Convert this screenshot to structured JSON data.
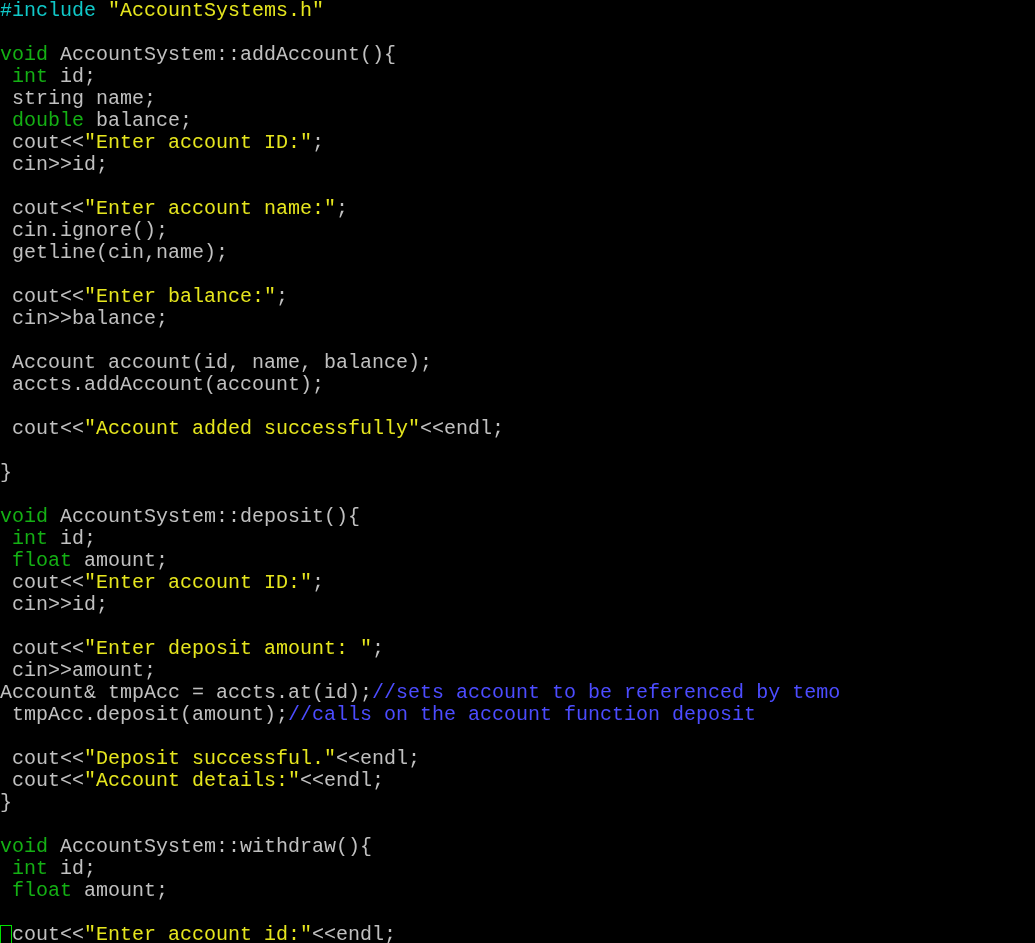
{
  "editor": {
    "lines": [
      {
        "kind": "code",
        "segments": [
          {
            "text": "#include ",
            "kind": "preproc"
          },
          {
            "text": "\"AccountSystems.h\"",
            "kind": "string"
          }
        ]
      },
      {
        "kind": "blank"
      },
      {
        "kind": "code",
        "segments": [
          {
            "text": "void",
            "kind": "keyword"
          },
          {
            "text": " AccountSystem::addAccount(){",
            "kind": "plain"
          }
        ]
      },
      {
        "kind": "code",
        "segments": [
          {
            "text": " int",
            "kind": "keyword"
          },
          {
            "text": " id;",
            "kind": "plain"
          }
        ]
      },
      {
        "kind": "code",
        "segments": [
          {
            "text": " string name;",
            "kind": "plain"
          }
        ]
      },
      {
        "kind": "code",
        "segments": [
          {
            "text": " double",
            "kind": "keyword"
          },
          {
            "text": " balance;",
            "kind": "plain"
          }
        ]
      },
      {
        "kind": "code",
        "segments": [
          {
            "text": " cout<<",
            "kind": "plain"
          },
          {
            "text": "\"Enter account ID:\"",
            "kind": "string"
          },
          {
            "text": ";",
            "kind": "plain"
          }
        ]
      },
      {
        "kind": "code",
        "segments": [
          {
            "text": " cin>>id;",
            "kind": "plain"
          }
        ]
      },
      {
        "kind": "blank"
      },
      {
        "kind": "code",
        "segments": [
          {
            "text": " cout<<",
            "kind": "plain"
          },
          {
            "text": "\"Enter account name:\"",
            "kind": "string"
          },
          {
            "text": ";",
            "kind": "plain"
          }
        ]
      },
      {
        "kind": "code",
        "segments": [
          {
            "text": " cin.ignore();",
            "kind": "plain"
          }
        ]
      },
      {
        "kind": "code",
        "segments": [
          {
            "text": " getline(cin,name);",
            "kind": "plain"
          }
        ]
      },
      {
        "kind": "blank"
      },
      {
        "kind": "code",
        "segments": [
          {
            "text": " cout<<",
            "kind": "plain"
          },
          {
            "text": "\"Enter balance:\"",
            "kind": "string"
          },
          {
            "text": ";",
            "kind": "plain"
          }
        ]
      },
      {
        "kind": "code",
        "segments": [
          {
            "text": " cin>>balance;",
            "kind": "plain"
          }
        ]
      },
      {
        "kind": "blank"
      },
      {
        "kind": "code",
        "segments": [
          {
            "text": " Account account(id, name, balance);",
            "kind": "plain"
          }
        ]
      },
      {
        "kind": "code",
        "segments": [
          {
            "text": " accts.addAccount(account);",
            "kind": "plain"
          }
        ]
      },
      {
        "kind": "blank"
      },
      {
        "kind": "code",
        "segments": [
          {
            "text": " cout<<",
            "kind": "plain"
          },
          {
            "text": "\"Account added successfully\"",
            "kind": "string"
          },
          {
            "text": "<<endl;",
            "kind": "plain"
          }
        ]
      },
      {
        "kind": "blank"
      },
      {
        "kind": "code",
        "segments": [
          {
            "text": "}",
            "kind": "plain"
          }
        ]
      },
      {
        "kind": "blank"
      },
      {
        "kind": "code",
        "segments": [
          {
            "text": "void",
            "kind": "keyword"
          },
          {
            "text": " AccountSystem::deposit(){",
            "kind": "plain"
          }
        ]
      },
      {
        "kind": "code",
        "segments": [
          {
            "text": " int",
            "kind": "keyword"
          },
          {
            "text": " id;",
            "kind": "plain"
          }
        ]
      },
      {
        "kind": "code",
        "segments": [
          {
            "text": " float",
            "kind": "keyword"
          },
          {
            "text": " amount;",
            "kind": "plain"
          }
        ]
      },
      {
        "kind": "code",
        "segments": [
          {
            "text": " cout<<",
            "kind": "plain"
          },
          {
            "text": "\"Enter account ID:\"",
            "kind": "string"
          },
          {
            "text": ";",
            "kind": "plain"
          }
        ]
      },
      {
        "kind": "code",
        "segments": [
          {
            "text": " cin>>id;",
            "kind": "plain"
          }
        ]
      },
      {
        "kind": "blank"
      },
      {
        "kind": "code",
        "segments": [
          {
            "text": " cout<<",
            "kind": "plain"
          },
          {
            "text": "\"Enter deposit amount: \"",
            "kind": "string"
          },
          {
            "text": ";",
            "kind": "plain"
          }
        ]
      },
      {
        "kind": "code",
        "segments": [
          {
            "text": " cin>>amount;",
            "kind": "plain"
          }
        ]
      },
      {
        "kind": "code",
        "segments": [
          {
            "text": "Account& tmpAcc = accts.at(id);",
            "kind": "plain"
          },
          {
            "text": "//sets account to be referenced by temo",
            "kind": "comment"
          }
        ]
      },
      {
        "kind": "code",
        "segments": [
          {
            "text": " tmpAcc.deposit(amount);",
            "kind": "plain"
          },
          {
            "text": "//calls on the account function deposit",
            "kind": "comment"
          }
        ]
      },
      {
        "kind": "blank"
      },
      {
        "kind": "code",
        "segments": [
          {
            "text": " cout<<",
            "kind": "plain"
          },
          {
            "text": "\"Deposit successful.\"",
            "kind": "string"
          },
          {
            "text": "<<endl;",
            "kind": "plain"
          }
        ]
      },
      {
        "kind": "code",
        "segments": [
          {
            "text": " cout<<",
            "kind": "plain"
          },
          {
            "text": "\"Account details:\"",
            "kind": "string"
          },
          {
            "text": "<<endl;",
            "kind": "plain"
          }
        ]
      },
      {
        "kind": "code",
        "segments": [
          {
            "text": "}",
            "kind": "plain"
          }
        ]
      },
      {
        "kind": "blank"
      },
      {
        "kind": "code",
        "segments": [
          {
            "text": "void",
            "kind": "keyword"
          },
          {
            "text": " AccountSystem::withdraw(){",
            "kind": "plain"
          }
        ]
      },
      {
        "kind": "code",
        "segments": [
          {
            "text": " int",
            "kind": "keyword"
          },
          {
            "text": " id;",
            "kind": "plain"
          }
        ]
      },
      {
        "kind": "code",
        "segments": [
          {
            "text": " float",
            "kind": "keyword"
          },
          {
            "text": " amount;",
            "kind": "plain"
          }
        ]
      },
      {
        "kind": "blank"
      },
      {
        "kind": "code",
        "segments": [
          {
            "kind": "cursor"
          },
          {
            "text": "cout<<",
            "kind": "plain"
          },
          {
            "text": "\"Enter account id:\"",
            "kind": "string"
          },
          {
            "text": "<<endl;",
            "kind": "plain"
          }
        ]
      }
    ]
  }
}
